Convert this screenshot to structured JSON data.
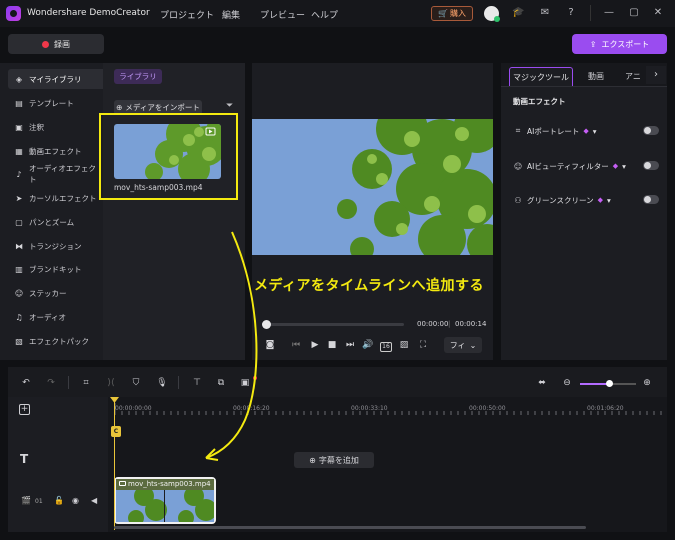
{
  "app": {
    "title": "Wondershare DemoCreator"
  },
  "menu": [
    "プロジェクト",
    "編集",
    "プレビュー",
    "ヘルプ"
  ],
  "titlebar": {
    "buy_label": "購入"
  },
  "record_label": "録画",
  "export_label": "エクスポート",
  "sidebar": {
    "items": [
      {
        "label": "マイライブラリ",
        "icon": "layers-icon",
        "glyph": "◈"
      },
      {
        "label": "テンプレート",
        "icon": "template-icon",
        "glyph": "▤"
      },
      {
        "label": "注釈",
        "icon": "annotation-icon",
        "glyph": "▣"
      },
      {
        "label": "動画エフェクト",
        "icon": "video-effect-icon",
        "glyph": "▦"
      },
      {
        "label": "オーディオエフェクト",
        "icon": "audio-effect-icon",
        "glyph": "♪"
      },
      {
        "label": "カーソルエフェクト",
        "icon": "cursor-effect-icon",
        "glyph": "➤"
      },
      {
        "label": "パンとズーム",
        "icon": "pan-zoom-icon",
        "glyph": "▢"
      },
      {
        "label": "トランジション",
        "icon": "transition-icon",
        "glyph": "⧓"
      },
      {
        "label": "ブランドキット",
        "icon": "brand-kit-icon",
        "glyph": "▥"
      },
      {
        "label": "ステッカー",
        "icon": "sticker-icon",
        "glyph": "☺"
      },
      {
        "label": "オーディオ",
        "icon": "audio-icon",
        "glyph": "♫"
      },
      {
        "label": "エフェクトパック",
        "icon": "effect-pack-icon",
        "glyph": "▧"
      }
    ]
  },
  "library": {
    "tab_label": "ライブラリ",
    "import_label": "メディアをインポート",
    "media_name": "mov_hts-samp003.mp4"
  },
  "preview": {
    "time_current": "00:00:00",
    "time_separator": "|",
    "time_total": "00:00:14",
    "fit_label": "フィ"
  },
  "annotation_text": "メディアをタイムラインへ追加する",
  "right_panel": {
    "tabs": [
      "マジックツール",
      "動画",
      "アニ"
    ],
    "section_title": "動画エフェクト",
    "effects": [
      {
        "label": "AIポートレート",
        "icon": "portrait-icon",
        "glyph": "⌗"
      },
      {
        "label": "AIビューティフィルター",
        "icon": "beauty-icon",
        "glyph": "☺"
      },
      {
        "label": "グリーンスクリーン",
        "icon": "green-screen-icon",
        "glyph": "⚇"
      }
    ]
  },
  "timeline": {
    "ruler_labels": [
      "00:00:00:00",
      "00:00:16:20",
      "00:00:33:10",
      "00:00:50:00",
      "00:01:06:20"
    ],
    "add_caption_label": "字幕を追加",
    "track_number": "01",
    "clip_name": "mov_hts-samp003.mp4",
    "playhead_marker": "C"
  },
  "colors": {
    "accent": "#9a4cf0",
    "highlight": "#f4ea10",
    "sky": "#7aa0d6",
    "foliage": "#5e9a2a"
  }
}
